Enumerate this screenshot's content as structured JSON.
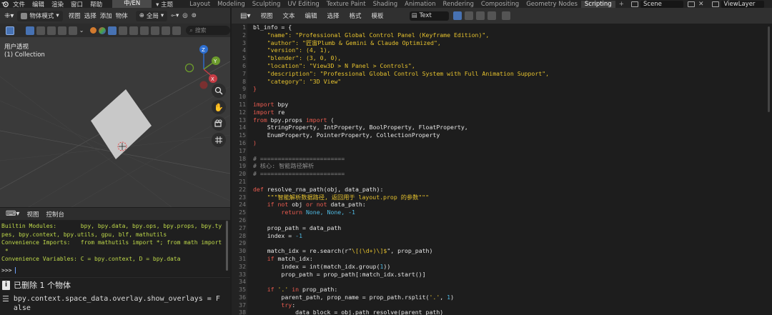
{
  "topbar": {
    "menus": [
      "文件",
      "编辑",
      "渲染",
      "窗口",
      "帮助"
    ],
    "language": "中/EN",
    "theme": "主题",
    "workspaces": [
      "Layout",
      "Modeling",
      "Sculpting",
      "UV Editing",
      "Texture Paint",
      "Shading",
      "Animation",
      "Rendering",
      "Compositing",
      "Geometry Nodes",
      "Scripting"
    ],
    "active_workspace": "Scripting",
    "add_tab": "+",
    "scene": "Scene",
    "view_layer": "ViewLayer"
  },
  "viewport": {
    "mode": "物体模式",
    "menus": [
      "视图",
      "选择",
      "添加",
      "物体"
    ],
    "transform": "全局",
    "search_placeholder": "搜索",
    "view_label": "用户透视",
    "collection_label": "(1) Collection",
    "gizmo_axes": [
      "Z",
      "Y",
      "X"
    ]
  },
  "console": {
    "menus": [
      "视图",
      "控制台"
    ],
    "lines": [
      "Builtin Modules:       bpy, bpy.data, bpy.ops, bpy.props, bpy.ty",
      "pes, bpy.context, bpy.utils, gpu, blf, mathutils",
      "Convenience Imports:   from mathutils import *; from math import",
      " *",
      "Convenience Variables: C = bpy.context, D = bpy.data"
    ],
    "prompt": ">>> "
  },
  "info": {
    "deleted": "已删除 1 个物体",
    "last_op": "bpy.context.space_data.overlay.show_overlays = False"
  },
  "editor": {
    "menus": [
      "视图",
      "文本",
      "编辑",
      "选择",
      "格式",
      "模板"
    ],
    "text_name": "Text",
    "lines": [
      {
        "n": "1",
        "code": [
          [
            "f",
            "bl_info = {"
          ]
        ]
      },
      {
        "n": "2",
        "code": [
          [
            "s",
            "    \"name\": \"Professional Global Control Panel (Keyframe Edition)\","
          ]
        ]
      },
      {
        "n": "3",
        "code": [
          [
            "s",
            "    \"author\": \"匠宙Plumb & Gemini & Claude Optimized\","
          ]
        ]
      },
      {
        "n": "4",
        "code": [
          [
            "s",
            "    \"version\": (4, 1),"
          ]
        ]
      },
      {
        "n": "5",
        "code": [
          [
            "s",
            "    \"blender\": (3, 0, 0),"
          ]
        ]
      },
      {
        "n": "6",
        "code": [
          [
            "s",
            "    \"location\": \"View3D > N Panel > Controls\","
          ]
        ]
      },
      {
        "n": "7",
        "code": [
          [
            "s",
            "    \"description\": \"Professional Global Control System with Full Animation Support\","
          ]
        ]
      },
      {
        "n": "8",
        "code": [
          [
            "s",
            "    \"category\": \"3D View\""
          ]
        ]
      },
      {
        "n": "9",
        "code": [
          [
            "k",
            "}"
          ]
        ]
      },
      {
        "n": "10",
        "code": []
      },
      {
        "n": "11",
        "code": [
          [
            "k",
            "import"
          ],
          [
            "f",
            " bpy"
          ]
        ]
      },
      {
        "n": "12",
        "code": [
          [
            "k",
            "import"
          ],
          [
            "f",
            " re"
          ]
        ]
      },
      {
        "n": "13",
        "code": [
          [
            "k",
            "from"
          ],
          [
            "f",
            " bpy.props "
          ],
          [
            "k",
            "import"
          ],
          [
            "f",
            " ("
          ]
        ]
      },
      {
        "n": "14",
        "code": [
          [
            "f",
            "    StringProperty, IntProperty, BoolProperty, FloatProperty,"
          ]
        ]
      },
      {
        "n": "15",
        "code": [
          [
            "f",
            "    EnumProperty, PointerProperty, CollectionProperty"
          ]
        ]
      },
      {
        "n": "16",
        "code": [
          [
            "k",
            ")"
          ]
        ]
      },
      {
        "n": "17",
        "code": []
      },
      {
        "n": "18",
        "code": [
          [
            "c",
            "# ========================"
          ]
        ]
      },
      {
        "n": "19",
        "code": [
          [
            "c",
            "# 核心: 智能路径解析"
          ]
        ]
      },
      {
        "n": "20",
        "code": [
          [
            "c",
            "# ========================"
          ]
        ]
      },
      {
        "n": "21",
        "code": []
      },
      {
        "n": "22",
        "code": [
          [
            "k",
            "def"
          ],
          [
            "f",
            " resolve_rna_path(obj, data_path):"
          ]
        ]
      },
      {
        "n": "23",
        "code": [
          [
            "s",
            "    \"\"\"智能解析数据路径, 返回用于 layout.prop 的参数\"\"\""
          ]
        ]
      },
      {
        "n": "24",
        "code": [
          [
            "k",
            "    if not"
          ],
          [
            "f",
            " obj "
          ],
          [
            "k",
            "or not"
          ],
          [
            "f",
            " data_path:"
          ]
        ]
      },
      {
        "n": "25",
        "code": [
          [
            "k",
            "        return"
          ],
          [
            "n",
            " None, None, -1"
          ]
        ]
      },
      {
        "n": "26",
        "code": []
      },
      {
        "n": "27",
        "code": [
          [
            "f",
            "    prop_path = data_path"
          ]
        ]
      },
      {
        "n": "28",
        "code": [
          [
            "f",
            "    index = "
          ],
          [
            "n",
            "-1"
          ]
        ]
      },
      {
        "n": "29",
        "code": []
      },
      {
        "n": "30",
        "code": [
          [
            "f",
            "    match_idx = re.search(r\""
          ],
          [
            "s",
            "\\[(\\d+)\\]$"
          ],
          [
            "f",
            "\", prop_path)"
          ]
        ]
      },
      {
        "n": "31",
        "code": [
          [
            "k",
            "    if"
          ],
          [
            "f",
            " match_idx:"
          ]
        ]
      },
      {
        "n": "32",
        "code": [
          [
            "f",
            "        index = int(match_idx.group("
          ],
          [
            "n",
            "1"
          ],
          [
            "f",
            "))"
          ]
        ]
      },
      {
        "n": "33",
        "code": [
          [
            "f",
            "        prop_path = prop_path[:match_idx.start()]"
          ]
        ]
      },
      {
        "n": "34",
        "code": []
      },
      {
        "n": "35",
        "code": [
          [
            "k",
            "    if"
          ],
          [
            "s",
            " '.'"
          ],
          [
            "k",
            " in"
          ],
          [
            "f",
            " prop_path:"
          ]
        ]
      },
      {
        "n": "36",
        "code": [
          [
            "f",
            "        parent_path, prop_name = prop_path.rsplit("
          ],
          [
            "s",
            "'.'"
          ],
          [
            "f",
            ", "
          ],
          [
            "n",
            "1"
          ],
          [
            "f",
            ")"
          ]
        ]
      },
      {
        "n": "37",
        "code": [
          [
            "k",
            "        try"
          ],
          [
            "f",
            ":"
          ]
        ]
      },
      {
        "n": "38",
        "code": [
          [
            "f",
            "            data_block = obj.path_resolve(parent_path)"
          ]
        ]
      }
    ]
  },
  "colors": {
    "accent": "#4772b3",
    "keyword": "#ec5c50",
    "string": "#e6c22e",
    "number": "#4fb8e0",
    "console_text": "#bfd94a"
  }
}
